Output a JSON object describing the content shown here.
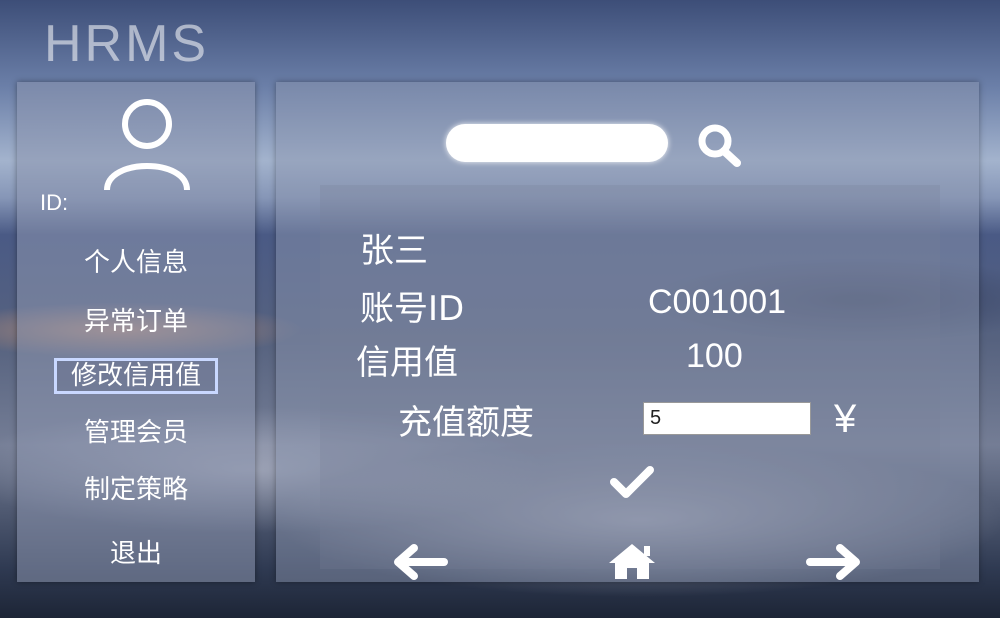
{
  "app": {
    "logo": "HRMS"
  },
  "sidebar": {
    "user_id_label": "ID:",
    "items": [
      {
        "label": "个人信息",
        "active": false
      },
      {
        "label": "异常订单",
        "active": false
      },
      {
        "label": "修改信用值",
        "active": true
      },
      {
        "label": "管理会员",
        "active": false
      },
      {
        "label": "制定策略",
        "active": false
      },
      {
        "label": "退出",
        "active": false
      }
    ]
  },
  "search": {
    "value": "",
    "placeholder": ""
  },
  "member": {
    "name": "张三",
    "account_id_label": "账号ID",
    "account_id": "C001001",
    "credit_label": "信用值",
    "credit_value": "100",
    "recharge_label": "充值额度",
    "recharge_value": "5",
    "currency_symbol": "¥"
  },
  "icons": {
    "avatar": "user-icon",
    "search": "search-icon",
    "confirm": "check-icon",
    "back": "arrow-left-icon",
    "home": "home-icon",
    "forward": "arrow-right-icon"
  }
}
